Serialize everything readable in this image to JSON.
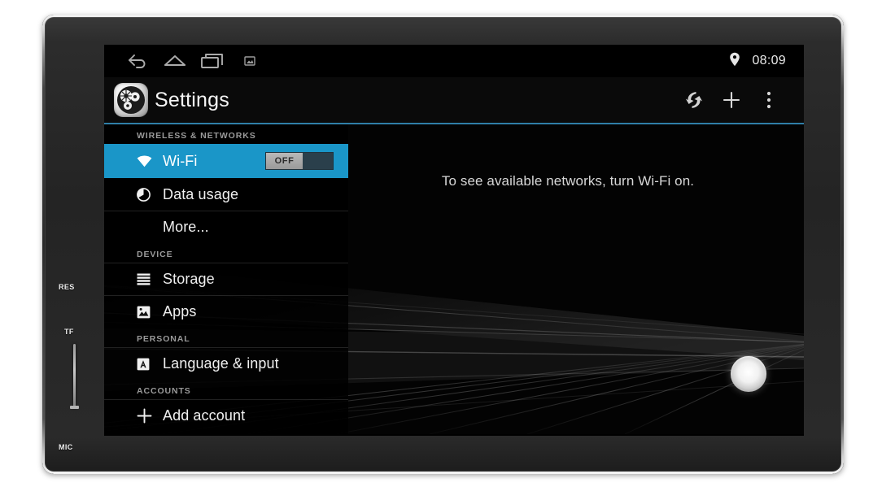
{
  "device": {
    "bezel_labels": {
      "reset": "RES",
      "tf_card": "TF",
      "microphone": "MIC"
    }
  },
  "statusbar": {
    "back_icon": "back-arrow-icon",
    "home_icon": "home-icon",
    "recents_icon": "recent-apps-icon",
    "screenshot_icon": "screenshot-icon",
    "location_icon": "location-pin-icon",
    "clock": "08:09"
  },
  "actionbar": {
    "app_icon": "settings-gears-icon",
    "title": "Settings",
    "sync_icon": "sync-icon",
    "add_icon": "plus-icon",
    "overflow_icon": "overflow-menu-icon",
    "accent_color": "#2f7fa8"
  },
  "settings_list": {
    "sections": [
      {
        "header": "WIRELESS & NETWORKS",
        "items": [
          {
            "label": "Wi-Fi",
            "icon": "wifi-icon",
            "selected": true,
            "toggle": {
              "state": "OFF"
            }
          },
          {
            "label": "Data usage",
            "icon": "data-usage-icon",
            "selected": false
          },
          {
            "label": "More...",
            "icon": "",
            "selected": false
          }
        ]
      },
      {
        "header": "DEVICE",
        "items": [
          {
            "label": "Storage",
            "icon": "storage-icon",
            "selected": false
          },
          {
            "label": "Apps",
            "icon": "apps-icon",
            "selected": false
          }
        ]
      },
      {
        "header": "PERSONAL",
        "items": [
          {
            "label": "Language & input",
            "icon": "language-icon",
            "selected": false
          }
        ]
      },
      {
        "header": "ACCOUNTS",
        "items": [
          {
            "label": "Add account",
            "icon": "plus-icon",
            "selected": false
          }
        ]
      }
    ]
  },
  "detail_pane": {
    "empty_message": "To see available networks, turn Wi-Fi on."
  },
  "colors": {
    "selection_blue": "#1a96c8",
    "divider_blue": "#2f7fa8",
    "screen_black": "#000000"
  }
}
